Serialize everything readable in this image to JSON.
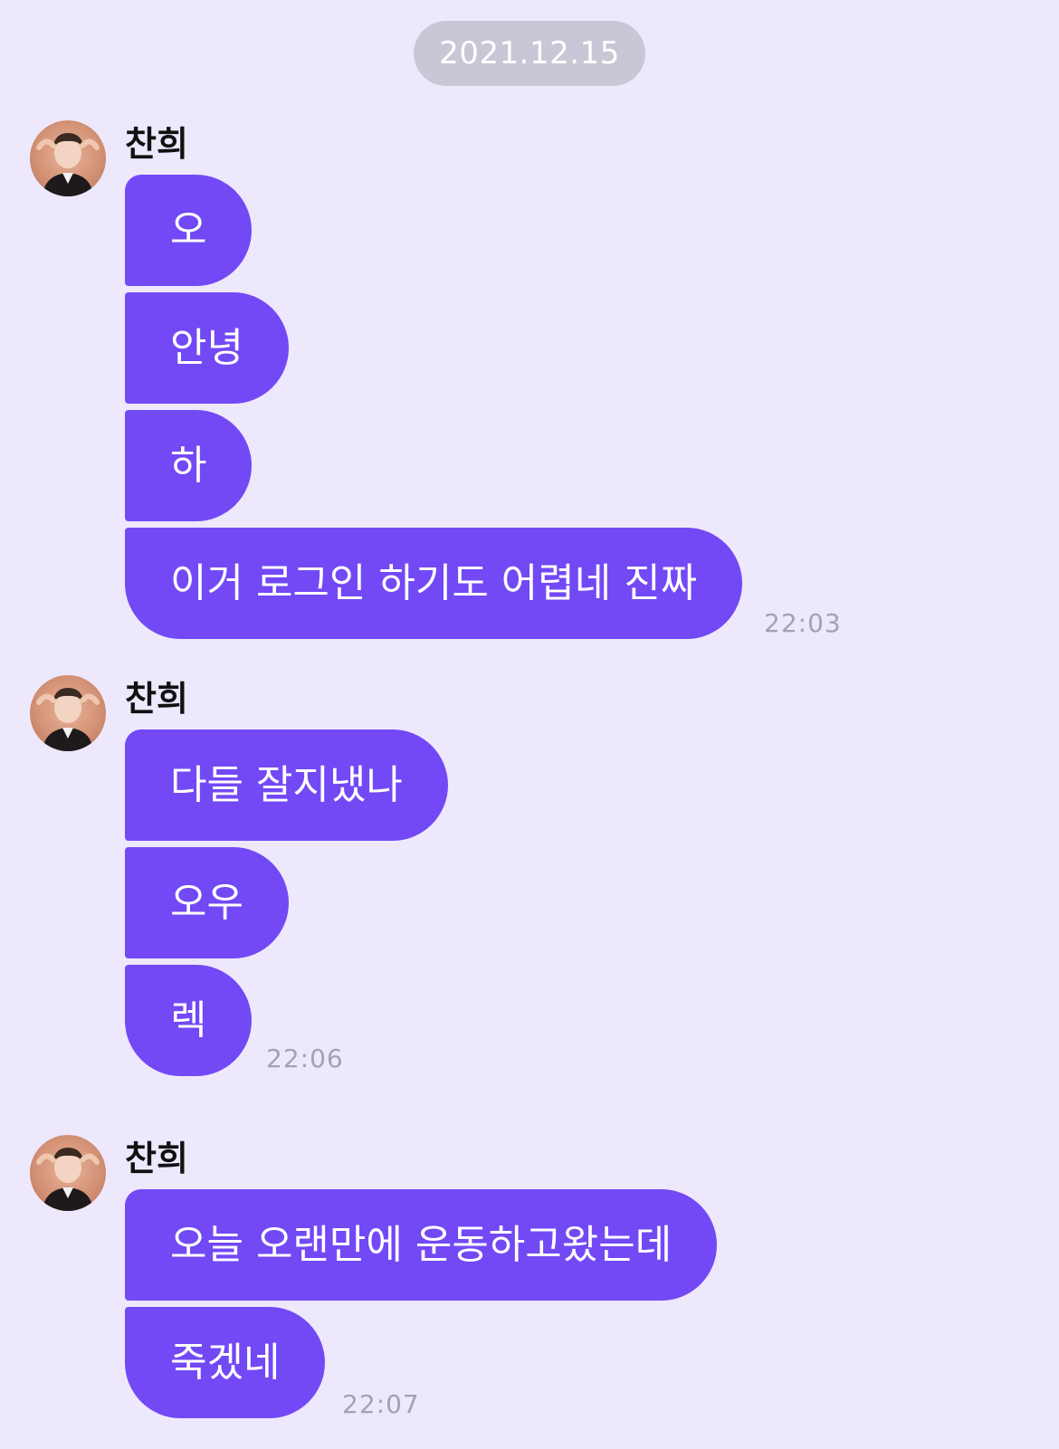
{
  "date_divider": "2021.12.15",
  "groups": [
    {
      "sender": "찬희",
      "messages": [
        "오",
        "안녕",
        "하",
        "이거 로그인 하기도 어렵네 진짜"
      ],
      "time": "22:03"
    },
    {
      "sender": "찬희",
      "messages": [
        "다들 잘지냈나",
        "오우",
        "렉"
      ],
      "time": "22:06"
    },
    {
      "sender": "찬희",
      "messages": [
        "오늘 오랜만에 운동하고왔는데",
        "죽겠네"
      ],
      "time": "22:07"
    }
  ],
  "colors": {
    "background": "#EEE8FC",
    "bubble": "#7249F5",
    "date_pill": "#CAC6D6",
    "timestamp": "#A5A1B0"
  },
  "icons": {
    "avatar": "profile-photo-avatar"
  }
}
